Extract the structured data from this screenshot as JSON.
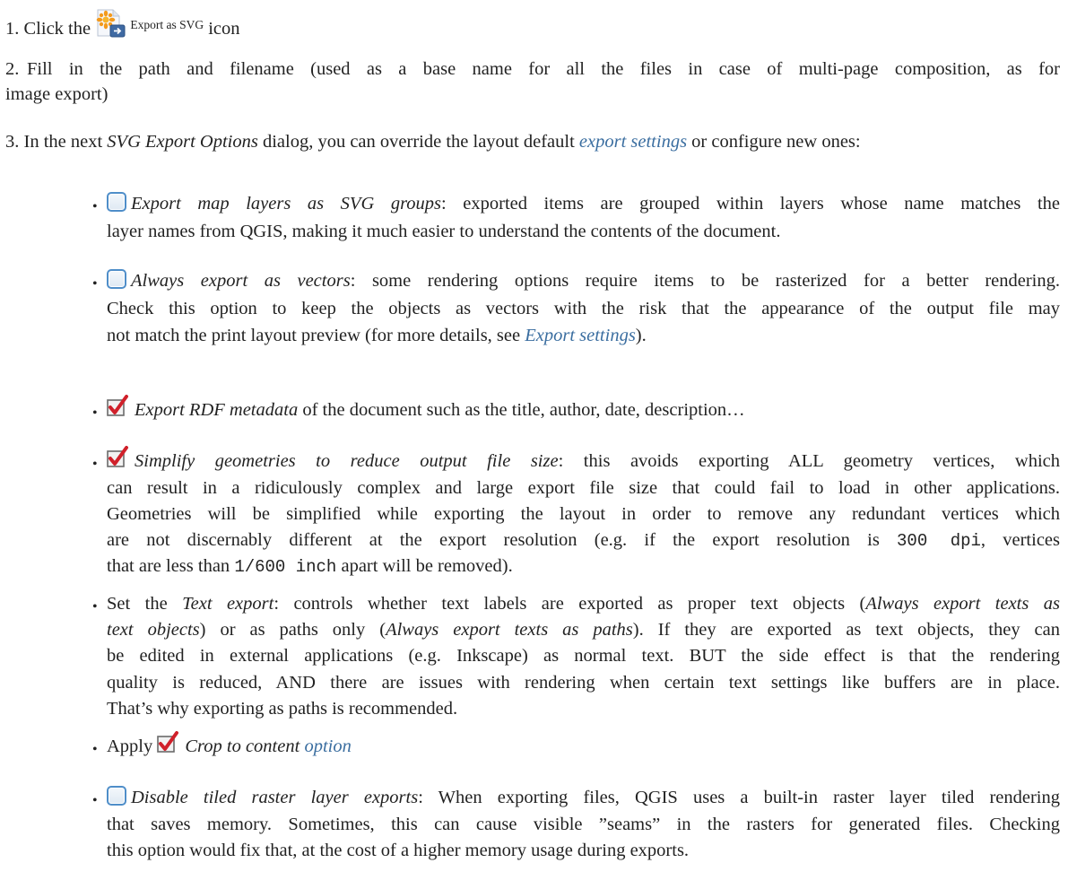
{
  "step1": {
    "number": "1.",
    "before": "Click the",
    "icon": "export-svg-icon",
    "icon_label": "Export as SVG",
    "after": "icon"
  },
  "step2": {
    "number": "2.",
    "line1": "Fill in the path and filename (used as a base name for all the files in case of multi-page composition, as for",
    "line2": "image export)"
  },
  "step3": {
    "number": "3.",
    "t1": "In the next ",
    "t2": "SVG Export Options",
    "t3": " dialog, you can override the layout default ",
    "link": "export settings",
    "t4": " or configure new ones:"
  },
  "options": {
    "map_layers": {
      "checked": false,
      "title": "Export map layers as SVG groups",
      "l1": ": exported items are grouped within layers whose name matches the",
      "l2": "layer names from QGIS, making it much easier to understand the contents of the document."
    },
    "vectors": {
      "checked": false,
      "title": "Always export as vectors",
      "l1": ": some rendering options require items to be rasterized for a better rendering.",
      "l2": "Check this option to keep the objects as vectors with the risk that the appearance of the output file may",
      "l3a": "not match the print layout preview (for more details, see ",
      "l3link": "Export settings",
      "l3b": ")."
    },
    "rdf": {
      "checked": true,
      "title": "Export RDF metadata",
      "l1": " of the document such as the title, author, date, description…"
    },
    "simplify": {
      "checked": true,
      "title": "Simplify geometries to reduce output file size",
      "l1": ": this avoids exporting ALL geometry vertices, which",
      "l2": "can result in a ridiculously complex and large export file size that could fail to load in other applications.",
      "l3": "Geometries will be simplified while exporting the layout in order to remove any redundant vertices which",
      "l4a": "are not discernably different at the export resolution (e.g. if the export resolution is ",
      "l4code": "300 dpi",
      "l4b": ", vertices",
      "l5a": "that are less than ",
      "l5code": "1/600 inch",
      "l5b": " apart will be removed)."
    },
    "text_export": {
      "l1a": "Set the ",
      "l1i": "Text export",
      "l1b": ": controls whether text labels are exported as proper text objects (",
      "l1i2": "Always export texts as",
      "l2i": "text objects",
      "l2a": ") or as paths only (",
      "l2i2": "Always export texts as paths",
      "l2b": "). If they are exported as text objects, they can",
      "l3": "be edited in external applications (e.g. Inkscape) as normal text. BUT the side effect is that the rendering",
      "l4": "quality is reduced, AND there are issues with rendering when certain text settings like buffers are in place.",
      "l5": "That’s why exporting as paths is recommended."
    },
    "crop": {
      "before": "Apply",
      "checked": true,
      "title": "Crop to content",
      "link": "option"
    },
    "tiled": {
      "checked": false,
      "title": "Disable tiled raster layer exports",
      "l1": ": When exporting files, QGIS uses a built-in raster layer tiled rendering",
      "l2": "that saves memory. Sometimes, this can cause visible ”seams” in the rasters for generated files. Checking",
      "l3": "this option would fix that, at the cost of a higher memory usage during exports."
    }
  },
  "bullet": "•",
  "colors": {
    "link": "#3b6ea0",
    "text": "#222222",
    "checkbox_border": "#4f8ec9",
    "check_red": "#d0202a"
  }
}
